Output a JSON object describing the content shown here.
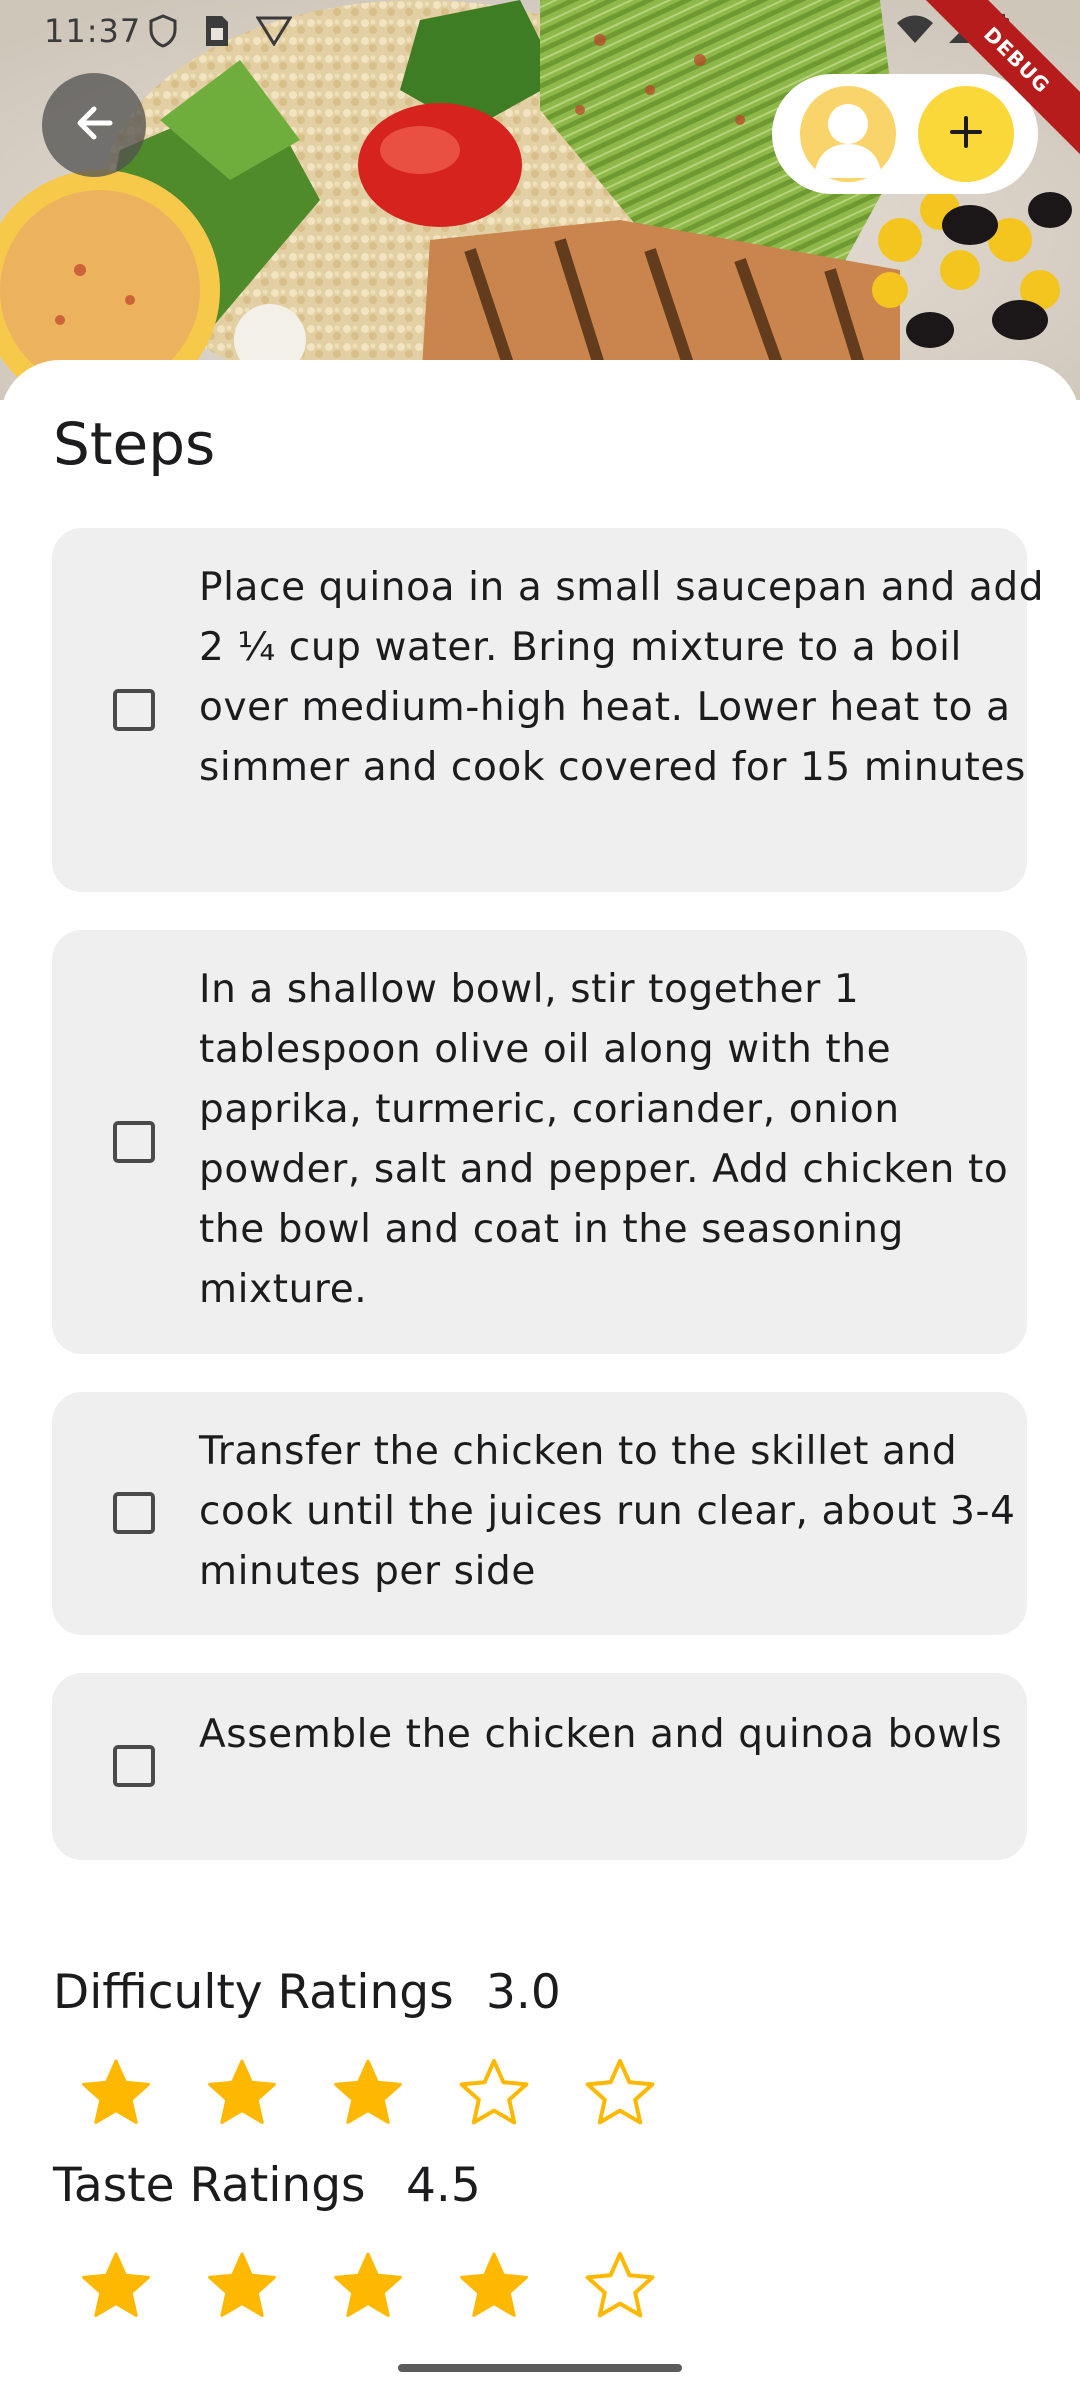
{
  "status_bar": {
    "time": "11:37",
    "icons_left": [
      "shield-icon",
      "sim-card-icon",
      "vpn-icon"
    ],
    "icons_right": [
      "wifi-icon",
      "signal-icon",
      "battery-icon"
    ]
  },
  "debug_banner": "DEBUG",
  "header": {
    "back_icon": "arrow-left-icon",
    "avatar_icon": "person-icon",
    "add_icon": "plus-icon"
  },
  "steps": {
    "title": "Steps",
    "items": [
      {
        "checked": false,
        "text": "Place quinoa in a small saucepan and add 2 ¼ cup water. Bring mixture to a boil over medium-high heat. Lower heat to a simmer and cook covered for 15 minutes"
      },
      {
        "checked": false,
        "text": "In a shallow bowl, stir together 1 tablespoon olive oil along with the paprika, turmeric, coriander, onion powder, salt and pepper. Add chicken to the bowl and coat in the seasoning mixture."
      },
      {
        "checked": false,
        "text": "Transfer the chicken to the skillet and cook until the juices run clear, about 3-4 minutes per side"
      },
      {
        "checked": false,
        "text": "Assemble the chicken and quinoa bowls"
      }
    ]
  },
  "ratings": {
    "difficulty": {
      "label": "Difficulty Ratings",
      "value": "3.0",
      "filled_stars": 3,
      "total_stars": 5
    },
    "taste": {
      "label": "Taste Ratings",
      "value": "4.5",
      "filled_stars": 4,
      "total_stars": 5
    }
  },
  "colors": {
    "accent": "#fbd83a",
    "star": "#ffb800",
    "card_bg": "#efefef",
    "debug": "#b71c1c"
  }
}
